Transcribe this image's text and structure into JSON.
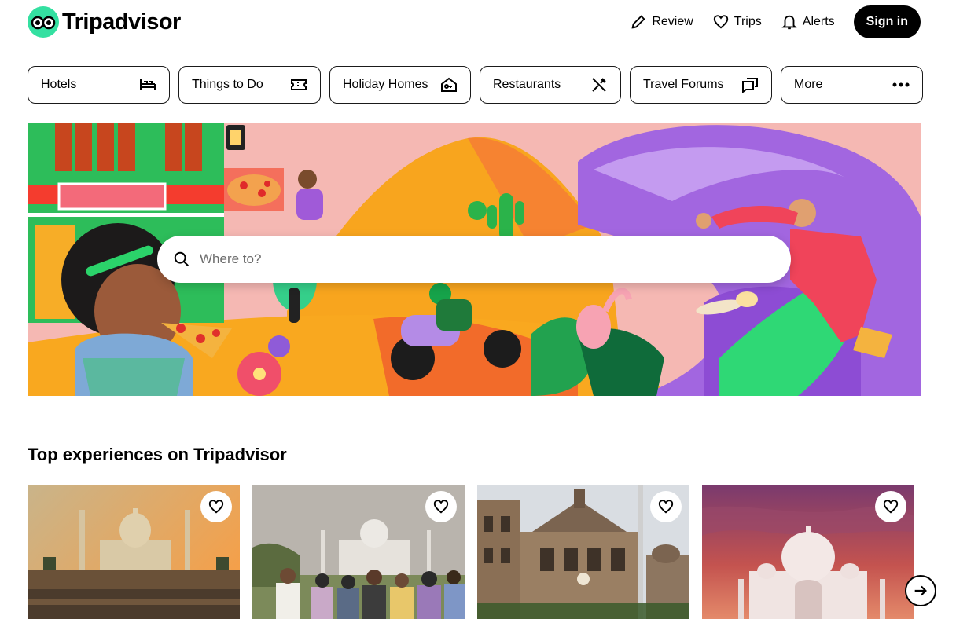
{
  "header": {
    "logo_text": "Tripadvisor",
    "logo_icon": "owl-eyes-logo",
    "nav": [
      {
        "label": "Review",
        "icon": "pencil-icon"
      },
      {
        "label": "Trips",
        "icon": "heart-icon"
      },
      {
        "label": "Alerts",
        "icon": "bell-icon"
      }
    ],
    "signin_label": "Sign in"
  },
  "tabs": [
    {
      "label": "Hotels",
      "icon": "bed-icon"
    },
    {
      "label": "Things to Do",
      "icon": "ticket-icon"
    },
    {
      "label": "Holiday Homes",
      "icon": "house-key-icon"
    },
    {
      "label": "Restaurants",
      "icon": "fork-knife-icon"
    },
    {
      "label": "Travel Forums",
      "icon": "chat-bubbles-icon"
    },
    {
      "label": "More",
      "icon": "more-dots-icon"
    }
  ],
  "hero": {
    "search_placeholder": "Where to?"
  },
  "section": {
    "title": "Top experiences on Tripadvisor"
  },
  "colors": {
    "brand_green": "#34e0a1",
    "black": "#000000"
  }
}
